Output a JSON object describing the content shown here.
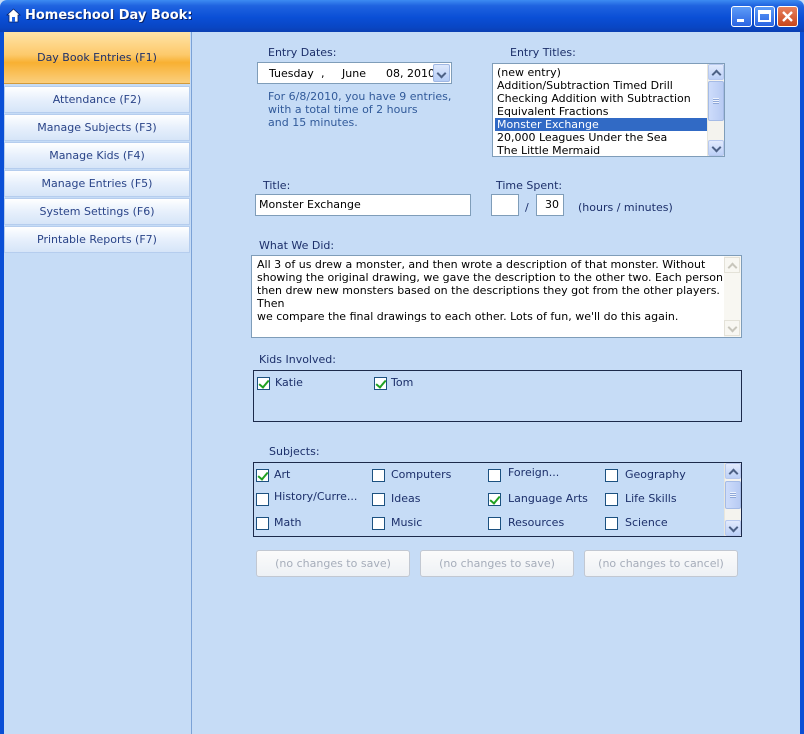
{
  "window": {
    "title": "Homeschool Day Book:"
  },
  "sidebar": {
    "items": [
      {
        "label": "Day Book Entries  (F1)"
      },
      {
        "label": "Attendance  (F2)"
      },
      {
        "label": "Manage Subjects  (F3)"
      },
      {
        "label": "Manage Kids  (F4)"
      },
      {
        "label": "Manage Entries  (F5)"
      },
      {
        "label": "System Settings  (F6)"
      },
      {
        "label": "Printable Reports  (F7)"
      }
    ]
  },
  "entry_dates": {
    "label": "Entry Dates:",
    "weekday": "Tuesday",
    "sep": ",",
    "month": "June",
    "day_year": "08, 2010",
    "info_lines": [
      "For 6/8/2010, you have 9 entries,",
      "with a total time of 2 hours",
      "and 15 minutes."
    ]
  },
  "entry_titles": {
    "label": "Entry Titles:",
    "items": [
      "(new entry)",
      "Addition/Subtraction Timed Drill",
      "Checking Addition with Subtraction",
      "Equivalent Fractions",
      "Monster Exchange",
      "20,000 Leagues Under the Sea",
      "The Little Mermaid"
    ],
    "selected": "Monster Exchange"
  },
  "title_field": {
    "label": "Title:",
    "value": "Monster Exchange"
  },
  "time_spent": {
    "label": "Time Spent:",
    "hours": "",
    "slash": "/",
    "minutes": "30",
    "units": "(hours / minutes)"
  },
  "what_we_did": {
    "label": "What We Did:",
    "lines": [
      "All 3 of us drew a monster, and then wrote a description of that monster.  Without",
      "showing the original drawing, we gave the description to the other two.  Each person",
      "then drew new monsters based on the descriptions they got from the other players.  Then",
      "we compare the final drawings to each other.  Lots of fun, we'll do this again."
    ]
  },
  "kids": {
    "label": "Kids Involved:",
    "items": [
      {
        "name": "Katie",
        "checked": true
      },
      {
        "name": "Tom",
        "checked": true
      }
    ]
  },
  "subjects": {
    "label": "Subjects:",
    "items": [
      {
        "name": "Art",
        "checked": true
      },
      {
        "name": "Computers",
        "checked": false
      },
      {
        "name": "Foreign...",
        "checked": false
      },
      {
        "name": "Geography",
        "checked": false
      },
      {
        "name": "History/Curre...",
        "checked": false
      },
      {
        "name": "Ideas",
        "checked": false
      },
      {
        "name": "Language Arts",
        "checked": true
      },
      {
        "name": "Life Skills",
        "checked": false
      },
      {
        "name": "Math",
        "checked": false
      },
      {
        "name": "Music",
        "checked": false
      },
      {
        "name": "Resources",
        "checked": false
      },
      {
        "name": "Science",
        "checked": false
      }
    ]
  },
  "buttons": {
    "save_1": "(no changes to save)",
    "save_2": "(no changes to save)",
    "cancel": "(no changes to cancel)"
  }
}
